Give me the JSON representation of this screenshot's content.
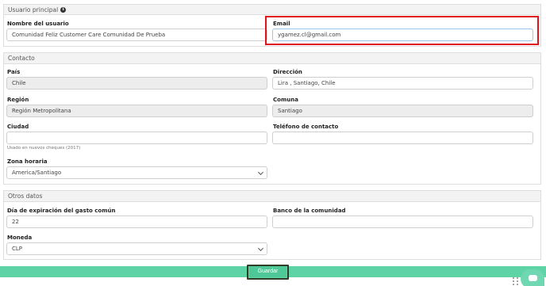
{
  "sections": {
    "main_user": "Usuario principal",
    "contact": "Contacto",
    "other": "Otros datos"
  },
  "fields": {
    "user_name": {
      "label": "Nombre del usuario",
      "value": "Comunidad Feliz Customer Care Comunidad De Prueba"
    },
    "email": {
      "label": "Email",
      "value": "ygamez.cl@gmail.com"
    },
    "country": {
      "label": "País",
      "value": "Chile"
    },
    "address": {
      "label": "Dirección",
      "value": "Lira , Santiago, Chile"
    },
    "region": {
      "label": "Región",
      "value": "Región Metropolitana"
    },
    "commune": {
      "label": "Comuna",
      "value": "Santiago"
    },
    "city": {
      "label": "Ciudad",
      "value": "",
      "hint": "Usado en nuevos cheques (2017)"
    },
    "phone": {
      "label": "Teléfono de contacto",
      "value": ""
    },
    "timezone": {
      "label": "Zona horaria",
      "value": "America/Santiago"
    },
    "expiration_day": {
      "label": "Día de expiración del gasto común",
      "value": "22"
    },
    "bank": {
      "label": "Banco de la comunidad",
      "value": ""
    },
    "currency": {
      "label": "Moneda",
      "value": "CLP"
    }
  },
  "actions": {
    "save_label": "Guardar"
  },
  "icons": {
    "info": "info-icon",
    "chat": "chat-icon",
    "grip": "drag-handle-icon"
  },
  "colors": {
    "highlight": "#e0121b",
    "footer": "#5ed3a5",
    "save_outline": "#2f3d27"
  }
}
